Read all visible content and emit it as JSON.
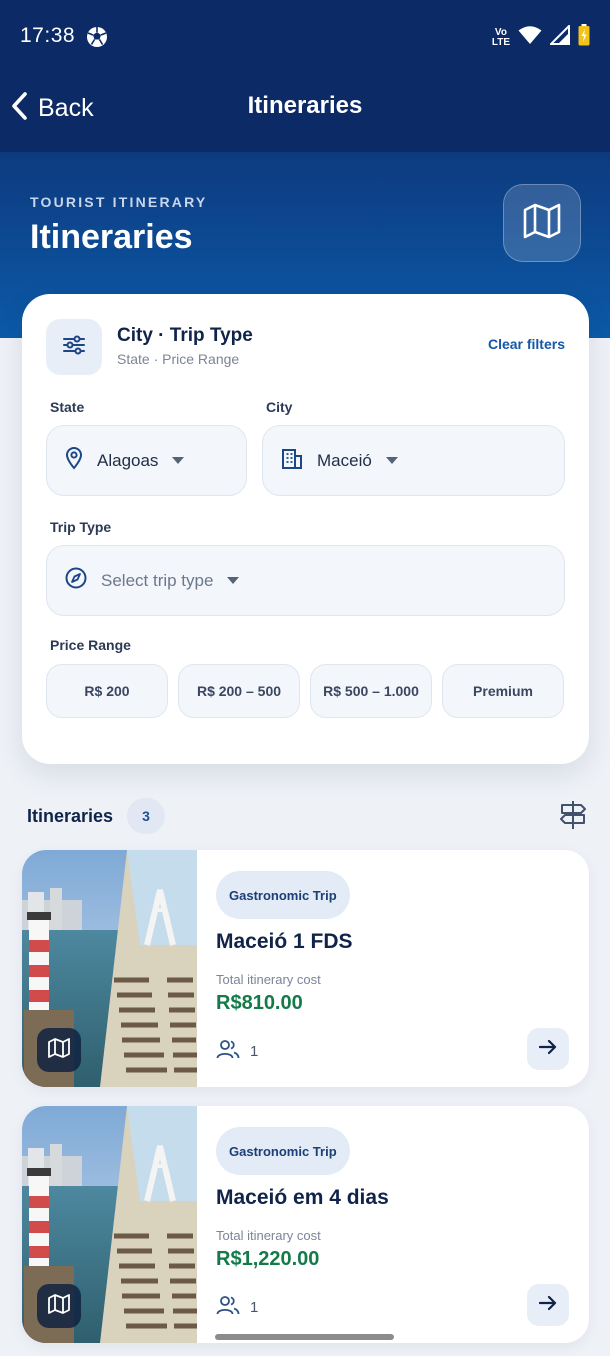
{
  "status_bar": {
    "time": "17:38",
    "volte_top": "Vo",
    "volte_bottom": "LTE"
  },
  "nav": {
    "back_label": "Back",
    "title": "Itineraries"
  },
  "hero": {
    "eyebrow": "TOURIST ITINERARY",
    "title": "Itineraries",
    "map_icon": "map-icon"
  },
  "filters": {
    "title": "City · Trip Type",
    "subtitle": "State · Price Range",
    "clear_label": "Clear filters",
    "state": {
      "label": "State",
      "value": "Alagoas"
    },
    "city": {
      "label": "City",
      "value": "Maceió"
    },
    "trip_type": {
      "label": "Trip Type",
      "placeholder": "Select trip type"
    },
    "price_range": {
      "label": "Price Range",
      "options": [
        "R$ 200",
        "R$ 200 – 500",
        "R$ 500 – 1.000",
        "Premium"
      ]
    }
  },
  "list": {
    "title": "Itineraries",
    "count": "3",
    "items": [
      {
        "badge": "Gastronomic Trip",
        "title": "Maceió 1 FDS",
        "cost_label": "Total itinerary cost",
        "cost": "R$810.00",
        "people": "1"
      },
      {
        "badge": "Gastronomic Trip",
        "title": "Maceió em 4 dias",
        "cost_label": "Total itinerary cost",
        "cost": "R$1,220.00",
        "people": "1"
      }
    ]
  },
  "colors": {
    "header_bg": "#0b2a66",
    "accent": "#1457a8",
    "price": "#157a4a"
  }
}
